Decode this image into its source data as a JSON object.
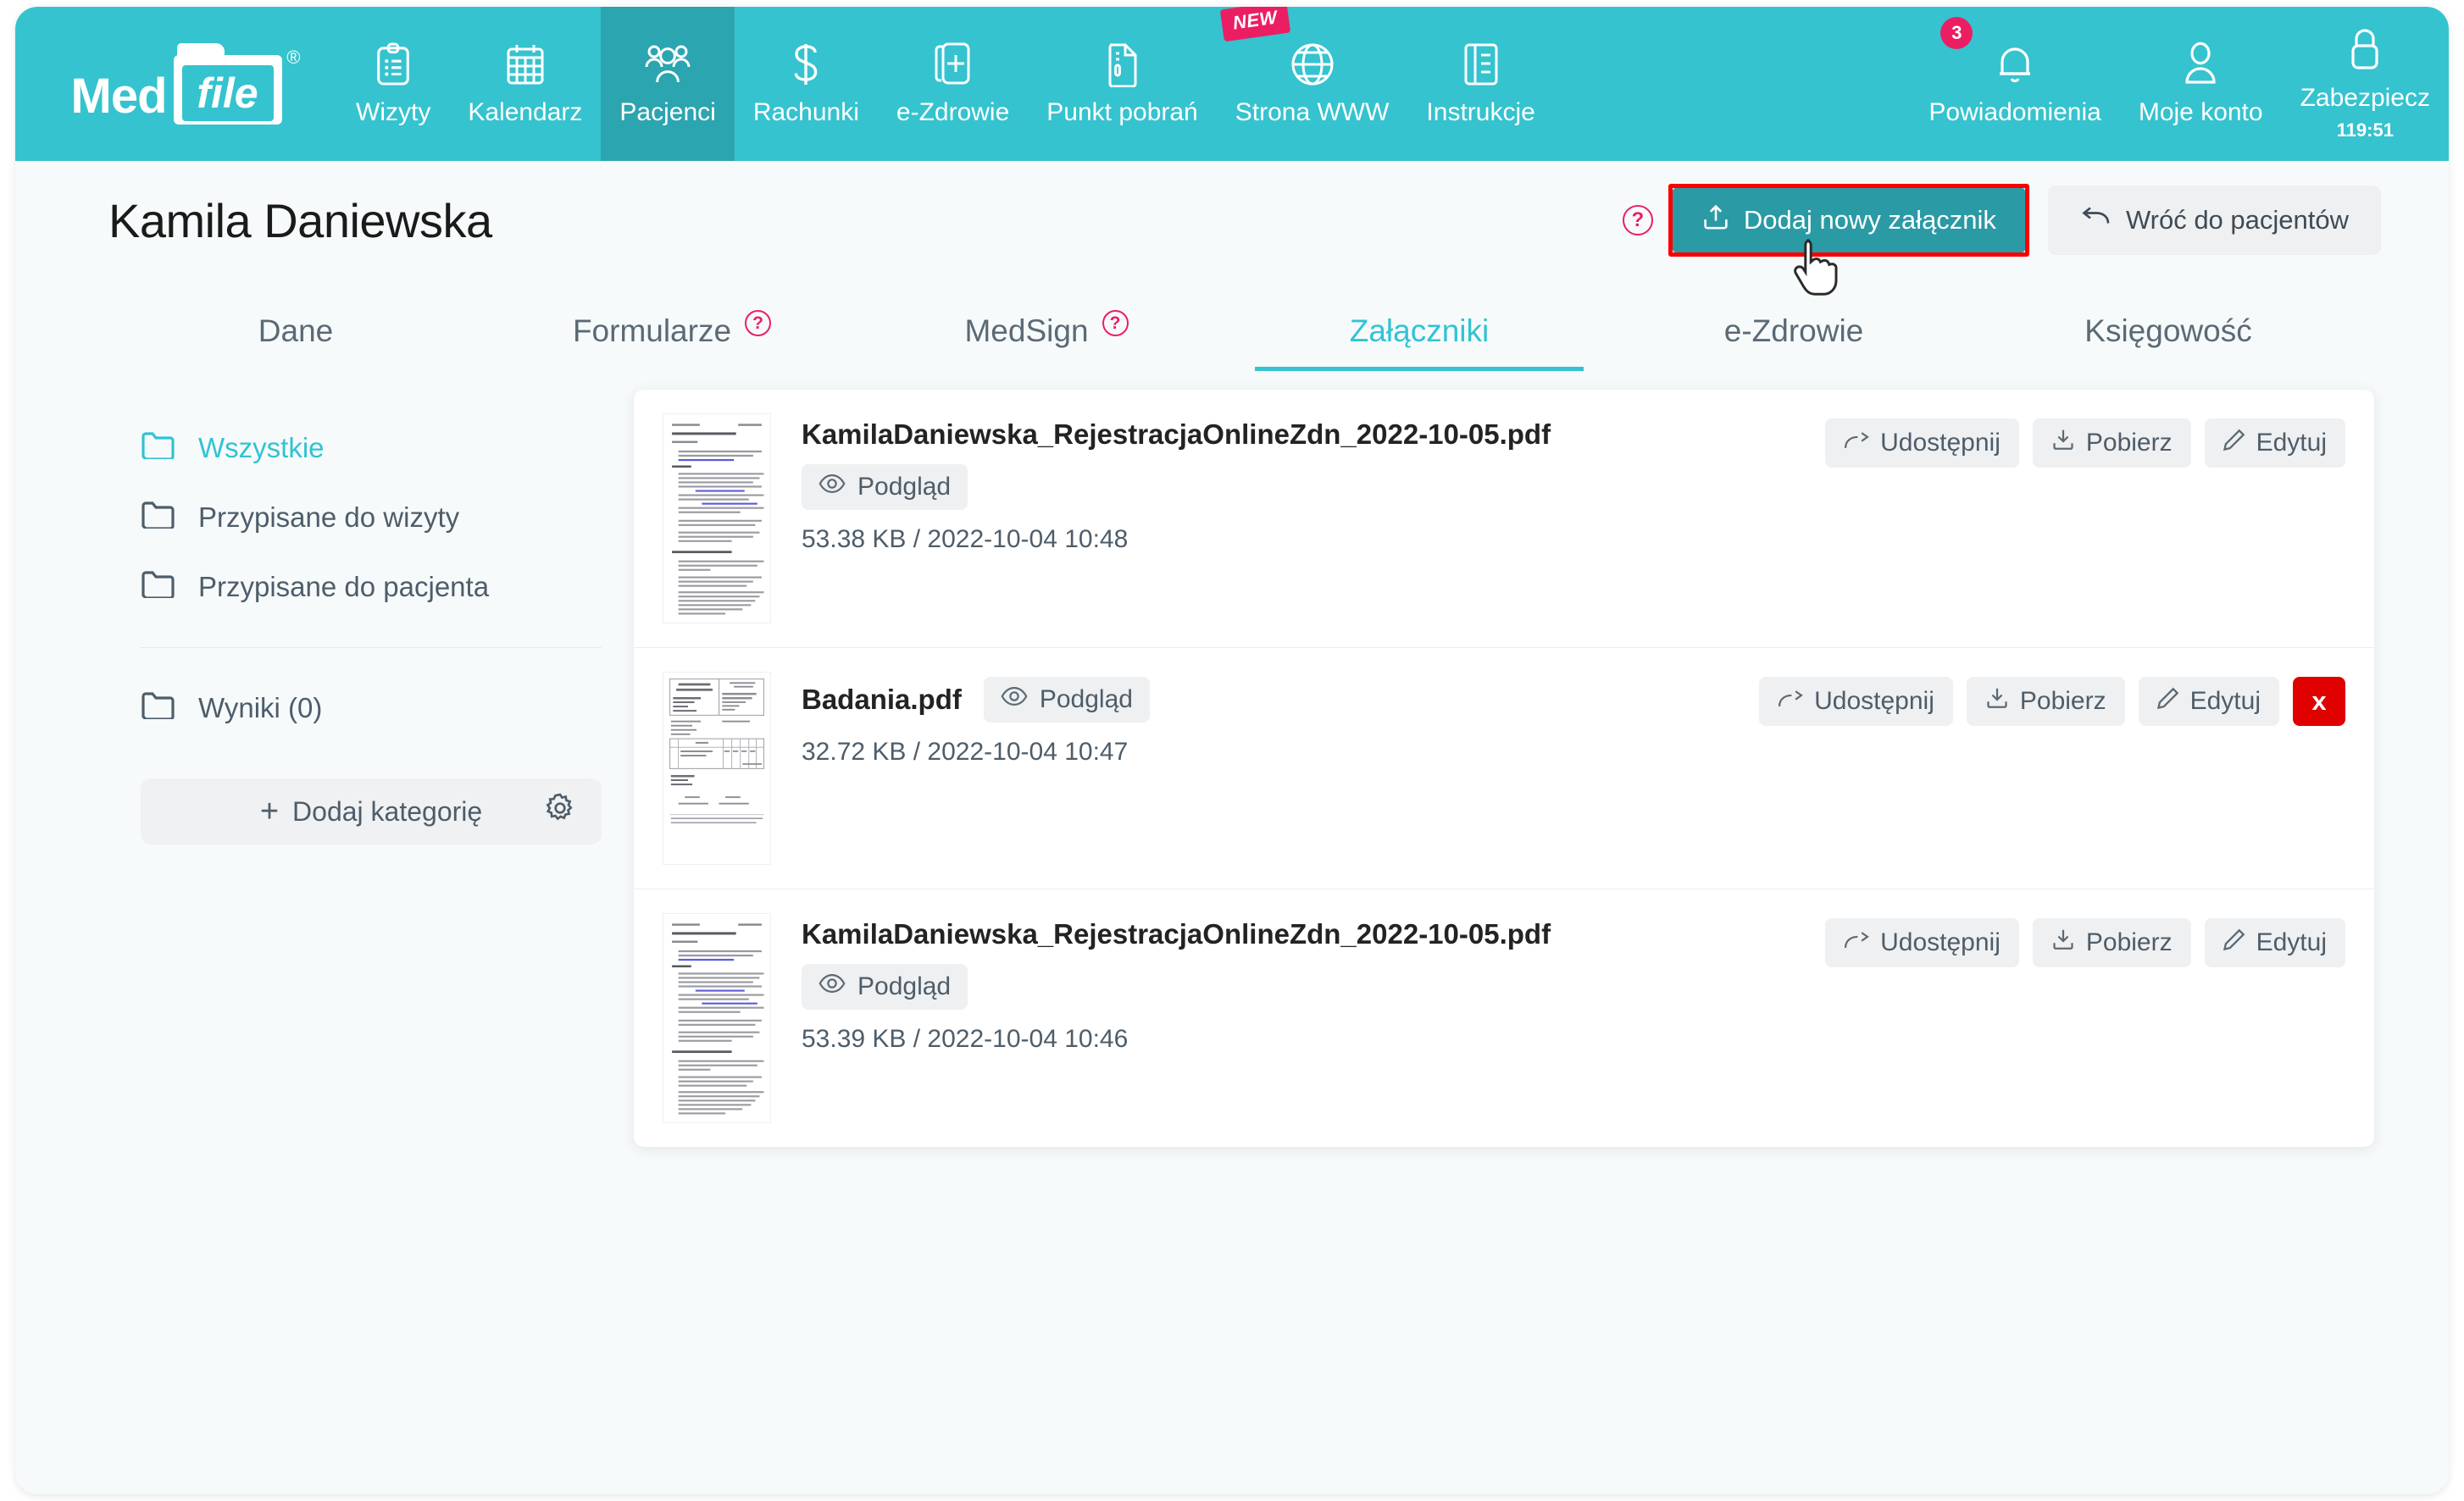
{
  "brand": {
    "name_part1": "Med",
    "name_part2": "file",
    "registered": "®"
  },
  "navbar": {
    "background": "#35c3cf",
    "active_background": "#2ba5b0",
    "items": [
      {
        "label": "Wizyty",
        "icon": "clipboard-icon",
        "active": false
      },
      {
        "label": "Kalendarz",
        "icon": "calendar-icon",
        "active": false
      },
      {
        "label": "Pacjenci",
        "icon": "patients-icon",
        "active": true
      },
      {
        "label": "Rachunki",
        "icon": "dollar-icon",
        "active": false
      },
      {
        "label": "e-Zdrowie",
        "icon": "health-card-icon",
        "active": false
      },
      {
        "label": "Punkt pobrań",
        "icon": "document-icon",
        "active": false
      },
      {
        "label": "Strona WWW",
        "icon": "globe-icon",
        "active": false,
        "badge": "NEW"
      },
      {
        "label": "Instrukcje",
        "icon": "book-icon",
        "active": false
      }
    ],
    "right_items": [
      {
        "label": "Powiadomienia",
        "icon": "bell-icon",
        "badge_count": "3"
      },
      {
        "label": "Moje konto",
        "icon": "user-icon"
      },
      {
        "label": "Zabezpiecz",
        "icon": "lock-icon",
        "sub": "119:51"
      }
    ]
  },
  "header": {
    "title": "Kamila Daniewska",
    "help_symbol": "?",
    "add_attachment_label": "Dodaj nowy załącznik",
    "back_label": "Wróć do pacjentów",
    "highlight_color": "#fa0000",
    "primary_color": "#2a9aa5"
  },
  "tabs": [
    {
      "label": "Dane",
      "active": false,
      "help": false
    },
    {
      "label": "Formularze",
      "active": false,
      "help": true
    },
    {
      "label": "MedSign",
      "active": false,
      "help": true
    },
    {
      "label": "Załączniki",
      "active": true,
      "help": false
    },
    {
      "label": "e-Zdrowie",
      "active": false,
      "help": false
    },
    {
      "label": "Księgowość",
      "active": false,
      "help": false
    }
  ],
  "sidebar": {
    "items": [
      {
        "label": "Wszystkie",
        "active": true
      },
      {
        "label": "Przypisane do wizyty",
        "active": false
      },
      {
        "label": "Przypisane do pacjenta",
        "active": false
      }
    ],
    "results": {
      "label": "Wyniki (0)"
    },
    "add_category": {
      "label": "Dodaj kategorię",
      "plus": "+"
    }
  },
  "attachments": {
    "actions": {
      "share": "Udostępnij",
      "download": "Pobierz",
      "edit": "Edytuj",
      "delete": "x",
      "preview": "Podgląd"
    },
    "rows": [
      {
        "name": "KamilaDaniewska_RejestracjaOnlineZdn_2022-10-05.pdf",
        "meta": "53.38 KB / 2022-10-04 10:48",
        "thumb": "text-document",
        "inline_preview": false,
        "deletable": false
      },
      {
        "name": "Badania.pdf",
        "meta": "32.72 KB / 2022-10-04 10:47",
        "thumb": "form-document",
        "inline_preview": true,
        "deletable": true
      },
      {
        "name": "KamilaDaniewska_RejestracjaOnlineZdn_2022-10-05.pdf",
        "meta": "53.39 KB / 2022-10-04 10:46",
        "thumb": "text-document",
        "inline_preview": false,
        "deletable": false
      }
    ]
  }
}
